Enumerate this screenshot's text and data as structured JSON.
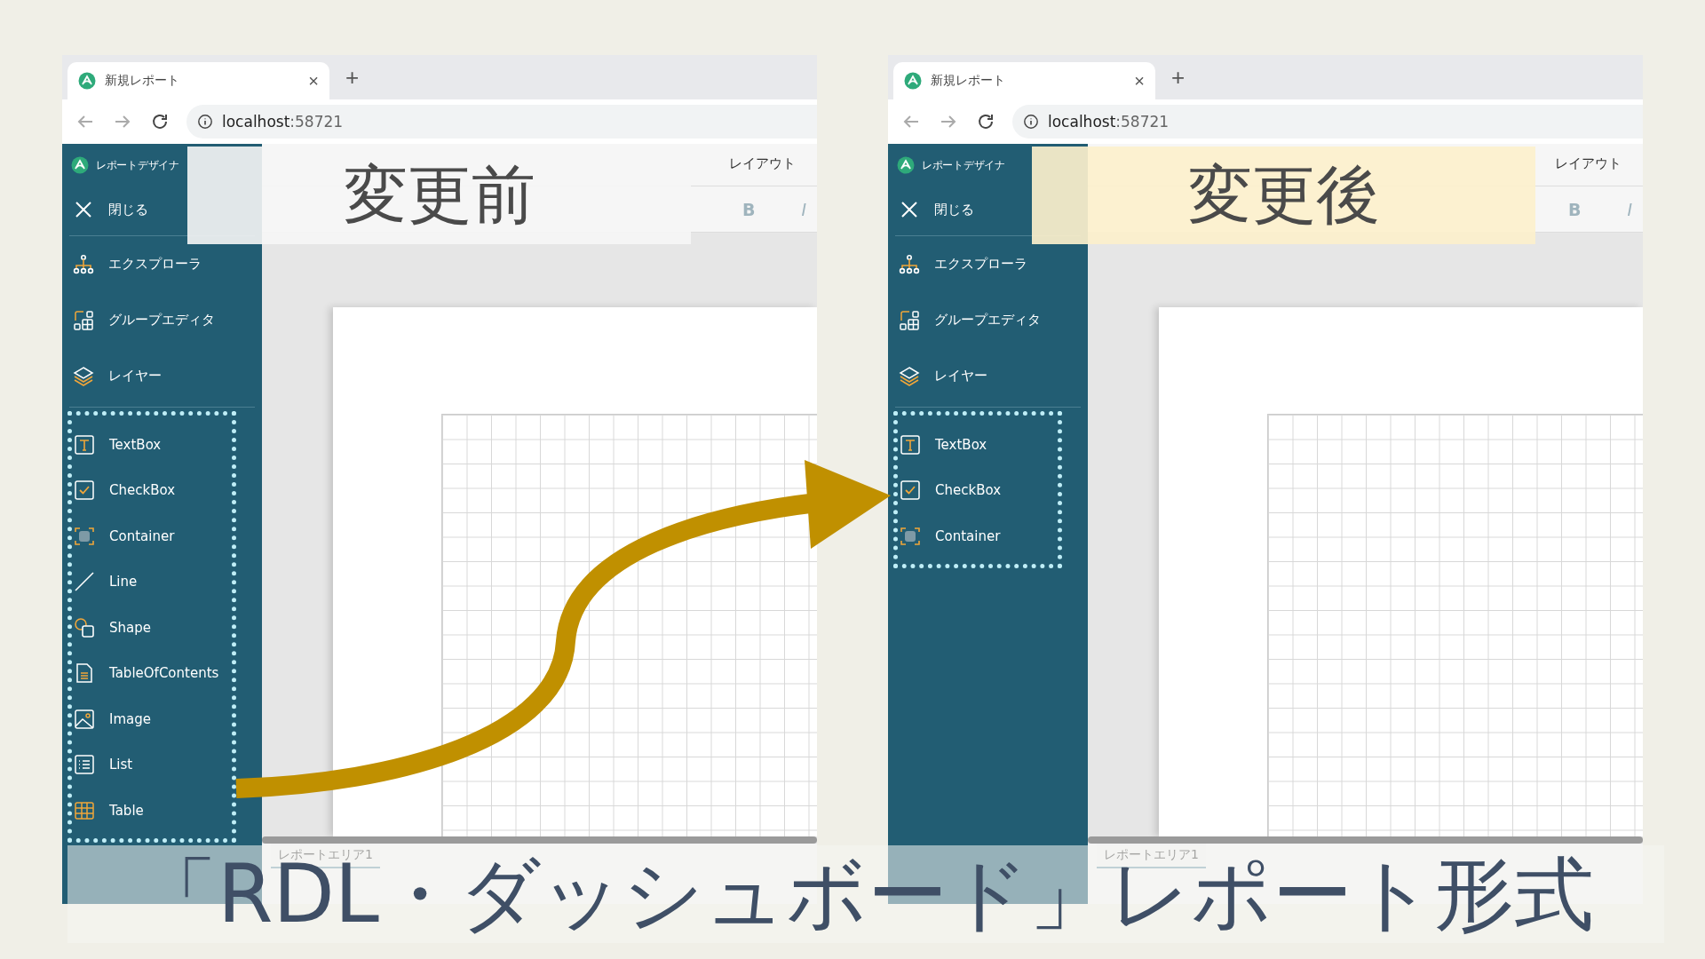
{
  "panels": [
    {
      "label": {
        "kind": "before",
        "text": "変更前"
      },
      "browser": {
        "tab_title": "新規レポート",
        "close": "×",
        "new_tab": "+",
        "url_host": "localhost",
        "url_port": ":58721"
      },
      "app": {
        "title": "レポートデザイナ",
        "close": "閉じる",
        "bold": "B",
        "italic": "I",
        "tabs": [
          {
            "label": "レイアウト",
            "selected": false
          }
        ],
        "nav": [
          {
            "kind": "explorer",
            "label": "エクスプローラ"
          },
          {
            "kind": "group",
            "label": "グループエディタ"
          },
          {
            "kind": "layer",
            "label": "レイヤー"
          }
        ],
        "tools": [
          {
            "kind": "textbox",
            "label": "TextBox"
          },
          {
            "kind": "checkbox",
            "label": "CheckBox"
          },
          {
            "kind": "container",
            "label": "Container"
          },
          {
            "kind": "line",
            "label": "Line"
          },
          {
            "kind": "shape",
            "label": "Shape"
          },
          {
            "kind": "toc",
            "label": "TableOfContents"
          },
          {
            "kind": "image",
            "label": "Image"
          },
          {
            "kind": "list",
            "label": "List"
          },
          {
            "kind": "table",
            "label": "Table"
          }
        ],
        "area_tab": "レポートエリア1"
      }
    },
    {
      "label": {
        "kind": "after",
        "text": "変更後"
      },
      "browser": {
        "tab_title": "新規レポート",
        "close": "×",
        "new_tab": "+",
        "url_host": "localhost",
        "url_port": ":58721"
      },
      "app": {
        "title": "レポートデザイナ",
        "close": "閉じる",
        "bold": "B",
        "italic": "I",
        "tabs": [
          {
            "label": "レイアウト",
            "selected": false
          }
        ],
        "nav": [
          {
            "kind": "explorer",
            "label": "エクスプローラ"
          },
          {
            "kind": "group",
            "label": "グループエディタ"
          },
          {
            "kind": "layer",
            "label": "レイヤー"
          }
        ],
        "tools": [
          {
            "kind": "textbox",
            "label": "TextBox"
          },
          {
            "kind": "checkbox",
            "label": "CheckBox"
          },
          {
            "kind": "container",
            "label": "Container"
          }
        ],
        "area_tab": "レポートエリア1"
      }
    }
  ],
  "caption": "「RDL・ダッシュボード」レポート形式"
}
